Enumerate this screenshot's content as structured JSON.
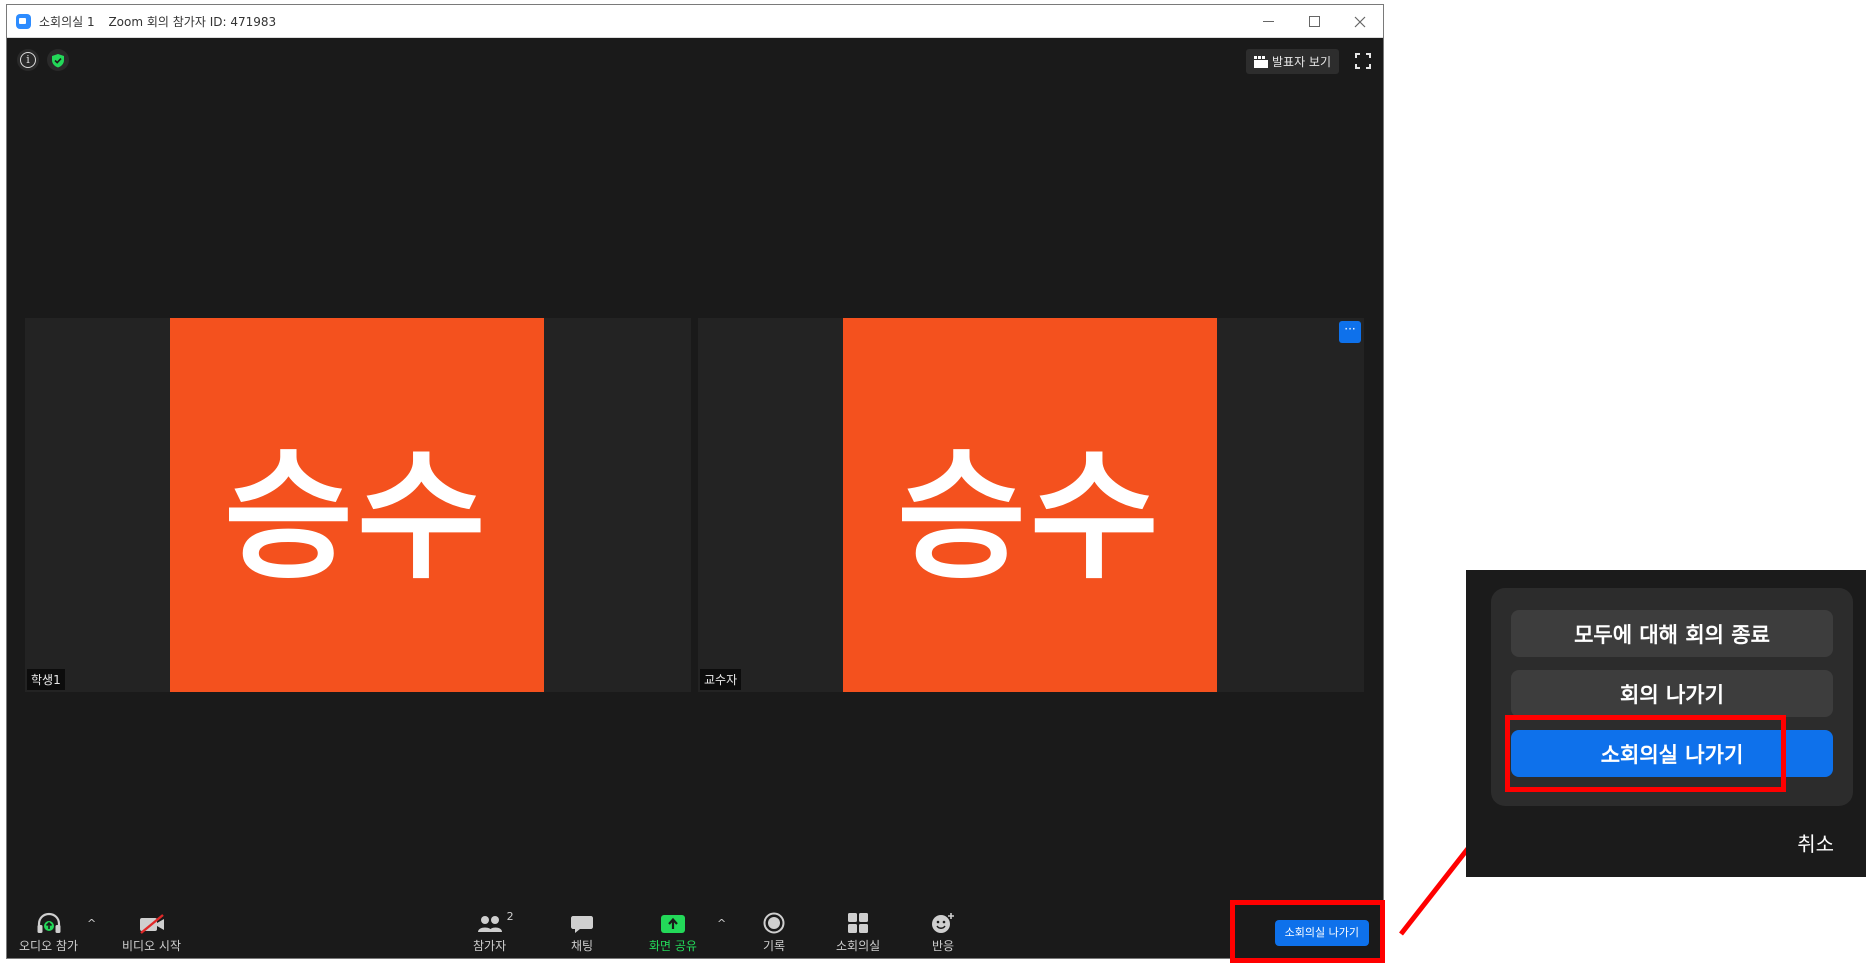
{
  "window": {
    "title_parts": [
      "소회의실 1",
      "Zoom 회의 참가자 ID: 471983"
    ],
    "controls": {
      "minimize": "—",
      "maximize": "☐",
      "close": "✕"
    }
  },
  "top_bar": {
    "speaker_view_label": "발표자 보기"
  },
  "participants": [
    {
      "name": "학생1",
      "avatar_text": "승수"
    },
    {
      "name": "교수자",
      "avatar_text": "승수"
    }
  ],
  "tile_more_label": "···",
  "toolbar": {
    "audio_label": "오디오 참가",
    "video_label": "비디오 시작",
    "participants_label": "참가자",
    "participants_count": "2",
    "chat_label": "채팅",
    "share_label": "화면 공유",
    "record_label": "기록",
    "breakout_label": "소회의실",
    "reactions_label": "반응",
    "caret": "^",
    "leave_room_label": "소회의실 나가기"
  },
  "dialog": {
    "end_all_label": "모두에 대해 회의 종료",
    "leave_meeting_label": "회의 나가기",
    "leave_room_label": "소회의실 나가기",
    "cancel_label": "취소"
  },
  "colors": {
    "accent": "#0e71eb",
    "avatar": "#f4511e",
    "share_green": "#23d959",
    "highlight": "#ff0000"
  }
}
